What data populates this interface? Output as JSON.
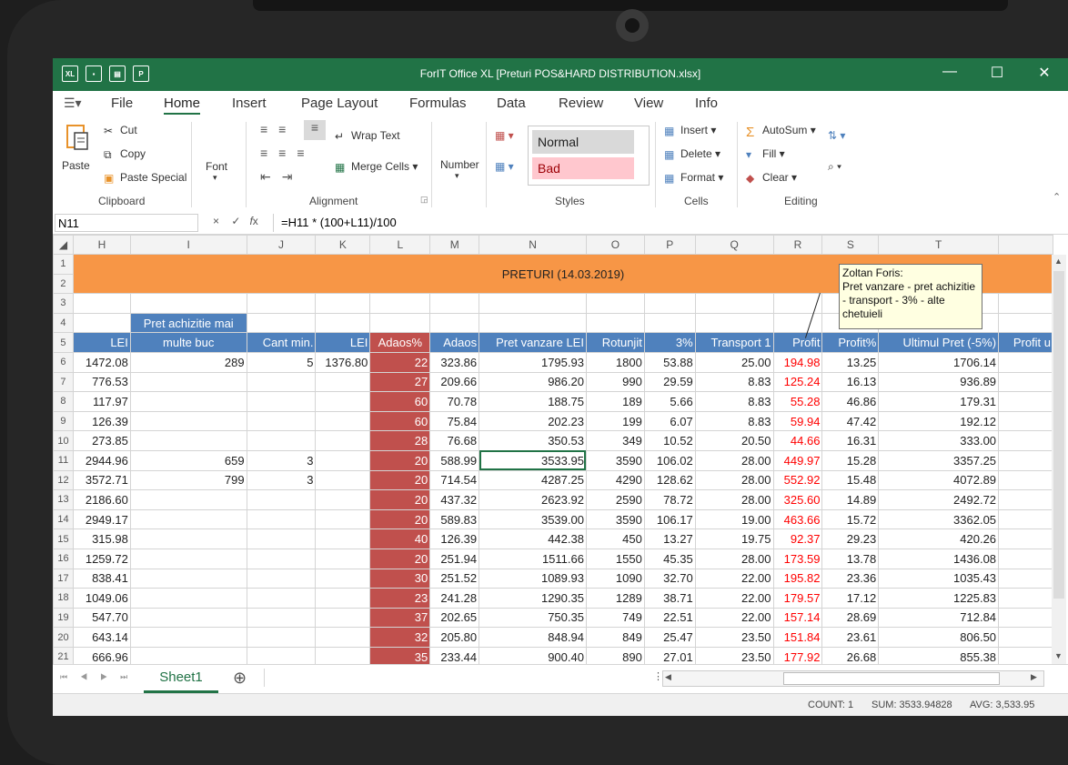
{
  "window": {
    "title": "ForIT Office XL [Preturi POS&HARD DISTRIBUTION.xlsx]",
    "minimize": "—",
    "maximize": "☐",
    "close": "✕"
  },
  "menu": {
    "items": [
      "File",
      "Home",
      "Insert",
      "Page Layout",
      "Formulas",
      "Data",
      "Review",
      "View",
      "Info"
    ]
  },
  "ribbon": {
    "clipboard": {
      "paste": "Paste",
      "cut": "Cut",
      "copy": "Copy",
      "paste_special": "Paste Special",
      "label": "Clipboard"
    },
    "font": {
      "label": "Font"
    },
    "alignment": {
      "wrap_text": "Wrap Text",
      "merge_cells": "Merge Cells",
      "label": "Alignment"
    },
    "number": {
      "label": "Number"
    },
    "styles": {
      "normal": "Normal",
      "bad": "Bad",
      "label": "Styles"
    },
    "cells": {
      "insert": "Insert",
      "delete": "Delete",
      "format": "Format",
      "label": "Cells"
    },
    "editing": {
      "autosum": "AutoSum",
      "fill": "Fill",
      "clear": "Clear",
      "label": "Editing"
    }
  },
  "formula_bar": {
    "name_box": "N11",
    "formula": "=H11 * (100+L11)/100"
  },
  "columns": [
    "H",
    "I",
    "J",
    "K",
    "L",
    "M",
    "N",
    "O",
    "P",
    "Q",
    "R",
    "S",
    "T",
    ""
  ],
  "sheet": {
    "title": "PRETURI (14.03.2019)",
    "header4_i": "Pret achizitie mai",
    "header5": [
      "LEI",
      "multe buc",
      "Cant min.",
      "LEI",
      "Adaos%",
      "Adaos",
      "Pret vanzare LEI",
      "Rotunjit",
      "3%",
      "Transport 1",
      "Profit",
      "Profit%",
      "Ultimul Pret (-5%)",
      "Profit u"
    ],
    "rows": [
      {
        "n": "6",
        "c": [
          "1472.08",
          "289",
          "5",
          "1376.80",
          "22",
          "323.86",
          "1795.93",
          "1800",
          "53.88",
          "25.00",
          "194.98",
          "13.25",
          "1706.14",
          ""
        ]
      },
      {
        "n": "7",
        "c": [
          "776.53",
          "",
          "",
          "",
          "27",
          "209.66",
          "986.20",
          "990",
          "29.59",
          "8.83",
          "125.24",
          "16.13",
          "936.89",
          ""
        ]
      },
      {
        "n": "8",
        "c": [
          "117.97",
          "",
          "",
          "",
          "60",
          "70.78",
          "188.75",
          "189",
          "5.66",
          "8.83",
          "55.28",
          "46.86",
          "179.31",
          ""
        ]
      },
      {
        "n": "9",
        "c": [
          "126.39",
          "",
          "",
          "",
          "60",
          "75.84",
          "202.23",
          "199",
          "6.07",
          "8.83",
          "59.94",
          "47.42",
          "192.12",
          ""
        ]
      },
      {
        "n": "10",
        "c": [
          "273.85",
          "",
          "",
          "",
          "28",
          "76.68",
          "350.53",
          "349",
          "10.52",
          "20.50",
          "44.66",
          "16.31",
          "333.00",
          ""
        ]
      },
      {
        "n": "11",
        "c": [
          "2944.96",
          "659",
          "3",
          "",
          "20",
          "588.99",
          "3533.95",
          "3590",
          "106.02",
          "28.00",
          "449.97",
          "15.28",
          "3357.25",
          ""
        ]
      },
      {
        "n": "12",
        "c": [
          "3572.71",
          "799",
          "3",
          "",
          "20",
          "714.54",
          "4287.25",
          "4290",
          "128.62",
          "28.00",
          "552.92",
          "15.48",
          "4072.89",
          ""
        ]
      },
      {
        "n": "13",
        "c": [
          "2186.60",
          "",
          "",
          "",
          "20",
          "437.32",
          "2623.92",
          "2590",
          "78.72",
          "28.00",
          "325.60",
          "14.89",
          "2492.72",
          ""
        ]
      },
      {
        "n": "14",
        "c": [
          "2949.17",
          "",
          "",
          "",
          "20",
          "589.83",
          "3539.00",
          "3590",
          "106.17",
          "19.00",
          "463.66",
          "15.72",
          "3362.05",
          ""
        ]
      },
      {
        "n": "15",
        "c": [
          "315.98",
          "",
          "",
          "",
          "40",
          "126.39",
          "442.38",
          "450",
          "13.27",
          "19.75",
          "92.37",
          "29.23",
          "420.26",
          ""
        ]
      },
      {
        "n": "16",
        "c": [
          "1259.72",
          "",
          "",
          "",
          "20",
          "251.94",
          "1511.66",
          "1550",
          "45.35",
          "28.00",
          "173.59",
          "13.78",
          "1436.08",
          ""
        ]
      },
      {
        "n": "17",
        "c": [
          "838.41",
          "",
          "",
          "",
          "30",
          "251.52",
          "1089.93",
          "1090",
          "32.70",
          "22.00",
          "195.82",
          "23.36",
          "1035.43",
          ""
        ]
      },
      {
        "n": "18",
        "c": [
          "1049.06",
          "",
          "",
          "",
          "23",
          "241.28",
          "1290.35",
          "1289",
          "38.71",
          "22.00",
          "179.57",
          "17.12",
          "1225.83",
          ""
        ]
      },
      {
        "n": "19",
        "c": [
          "547.70",
          "",
          "",
          "",
          "37",
          "202.65",
          "750.35",
          "749",
          "22.51",
          "22.00",
          "157.14",
          "28.69",
          "712.84",
          ""
        ]
      },
      {
        "n": "20",
        "c": [
          "643.14",
          "",
          "",
          "",
          "32",
          "205.80",
          "848.94",
          "849",
          "25.47",
          "23.50",
          "151.84",
          "23.61",
          "806.50",
          ""
        ]
      },
      {
        "n": "21",
        "c": [
          "666.96",
          "",
          "",
          "",
          "35",
          "233.44",
          "900.40",
          "890",
          "27.01",
          "23.50",
          "177.92",
          "26.68",
          "855.38",
          ""
        ]
      }
    ]
  },
  "comment": {
    "author": "Zoltan Foris:",
    "text": "Pret vanzare - pret achizitie - transport - 3% - alte chetuieli"
  },
  "sheet_tabs": {
    "active": "Sheet1",
    "add": "⊕"
  },
  "status": {
    "count": "COUNT: 1",
    "sum": "SUM: 3533.94828",
    "avg": "AVG: 3,533.95"
  },
  "colors": {
    "accent": "#217346",
    "header_blue": "#4f81bd",
    "title_orange": "#f79646",
    "adaos_red": "#c0504d"
  }
}
